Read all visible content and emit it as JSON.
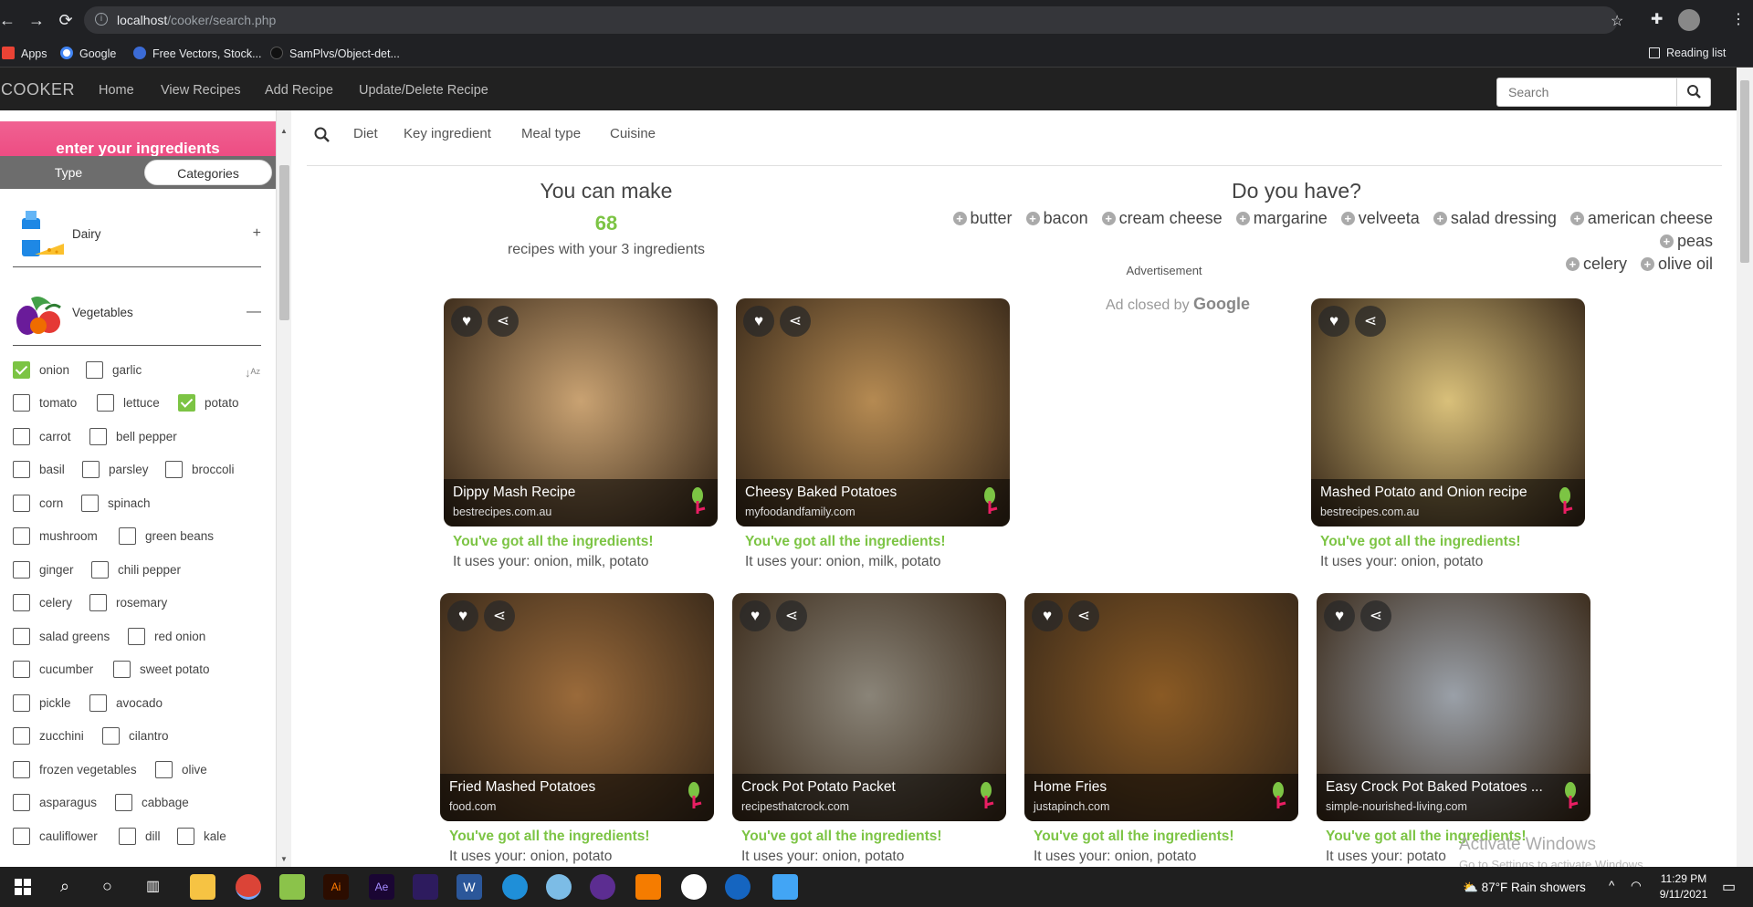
{
  "browser": {
    "url_host": "localhost",
    "url_path": "/cooker/search.php",
    "bookmarks": [
      "Apps",
      "Google",
      "Free Vectors, Stock...",
      "SamPlvs/Object-det..."
    ],
    "reading_list": "Reading list"
  },
  "navbar": {
    "brand": "COOKER",
    "links": [
      "Home",
      "View Recipes",
      "Add Recipe",
      "Update/Delete Recipe"
    ],
    "search_placeholder": "Search"
  },
  "sidebar": {
    "heading": "enter your ingredients",
    "tabs": [
      "Type",
      "Categories"
    ],
    "categories": [
      {
        "label": "Dairy",
        "toggle": "+"
      },
      {
        "label": "Vegetables",
        "toggle": "—"
      }
    ],
    "ingredients": [
      {
        "label": "onion",
        "checked": true
      },
      {
        "label": "garlic",
        "checked": false
      },
      {
        "label": "tomato",
        "checked": false
      },
      {
        "label": "lettuce",
        "checked": false
      },
      {
        "label": "potato",
        "checked": true
      },
      {
        "label": "carrot",
        "checked": false
      },
      {
        "label": "bell pepper",
        "checked": false
      },
      {
        "label": "basil",
        "checked": false
      },
      {
        "label": "parsley",
        "checked": false
      },
      {
        "label": "broccoli",
        "checked": false
      },
      {
        "label": "corn",
        "checked": false
      },
      {
        "label": "spinach",
        "checked": false
      },
      {
        "label": "mushroom",
        "checked": false
      },
      {
        "label": "green beans",
        "checked": false
      },
      {
        "label": "ginger",
        "checked": false
      },
      {
        "label": "chili pepper",
        "checked": false
      },
      {
        "label": "celery",
        "checked": false
      },
      {
        "label": "rosemary",
        "checked": false
      },
      {
        "label": "salad greens",
        "checked": false
      },
      {
        "label": "red onion",
        "checked": false
      },
      {
        "label": "cucumber",
        "checked": false
      },
      {
        "label": "sweet potato",
        "checked": false
      },
      {
        "label": "pickle",
        "checked": false
      },
      {
        "label": "avocado",
        "checked": false
      },
      {
        "label": "zucchini",
        "checked": false
      },
      {
        "label": "cilantro",
        "checked": false
      },
      {
        "label": "frozen vegetables",
        "checked": false
      },
      {
        "label": "olive",
        "checked": false
      },
      {
        "label": "asparagus",
        "checked": false
      },
      {
        "label": "cabbage",
        "checked": false
      },
      {
        "label": "cauliflower",
        "checked": false
      },
      {
        "label": "dill",
        "checked": false
      },
      {
        "label": "kale",
        "checked": false
      }
    ]
  },
  "filters": [
    "Diet",
    "Key ingredient",
    "Meal type",
    "Cuisine"
  ],
  "summary": {
    "title": "You can make",
    "count": "68",
    "subtitle": "recipes with your 3 ingredients"
  },
  "suggestions": {
    "title": "Do you have?",
    "items": [
      "butter",
      "bacon",
      "cream cheese",
      "margarine",
      "velveeta",
      "salad dressing",
      "american cheese",
      "peas",
      "celery",
      "olive oil"
    ]
  },
  "ad": {
    "label": "Advertisement",
    "closed_text": "Ad closed by",
    "brand": "Google"
  },
  "recipes": [
    {
      "title": "Dippy Mash Recipe",
      "source": "bestrecipes.com.au",
      "status": "You've got all the ingredients!",
      "uses": "It uses your: onion, milk, potato",
      "color": "#c9a272"
    },
    {
      "title": "Cheesy Baked Potatoes",
      "source": "myfoodandfamily.com",
      "status": "You've got all the ingredients!",
      "uses": "It uses your: onion, milk, potato",
      "color": "#b58a52"
    },
    {
      "title": "Mashed Potato and Onion recipe",
      "source": "bestrecipes.com.au",
      "status": "You've got all the ingredients!",
      "uses": "It uses your: onion, potato",
      "color": "#d9c07a"
    },
    {
      "title": "Fried Mashed Potatoes",
      "source": "food.com",
      "status": "You've got all the ingredients!",
      "uses": "It uses your: onion, potato",
      "color": "#9a6a3a"
    },
    {
      "title": "Crock Pot Potato Packet",
      "source": "recipesthatcrock.com",
      "status": "You've got all the ingredients!",
      "uses": "It uses your: onion, potato",
      "color": "#8a8478"
    },
    {
      "title": "Home Fries",
      "source": "justapinch.com",
      "status": "You've got all the ingredients!",
      "uses": "It uses your: onion, potato",
      "color": "#8a5a24"
    },
    {
      "title": "Easy Crock Pot Baked Potatoes ...",
      "source": "simple-nourished-living.com",
      "status": "You've got all the ingredients!",
      "uses": "It uses your: potato",
      "color": "#9aa0a8"
    }
  ],
  "watermark": {
    "line1": "Activate Windows",
    "line2": "Go to Settings to activate Windows."
  },
  "taskbar": {
    "weather": "87°F  Rain showers",
    "time": "11:29 PM",
    "date": "9/11/2021"
  }
}
